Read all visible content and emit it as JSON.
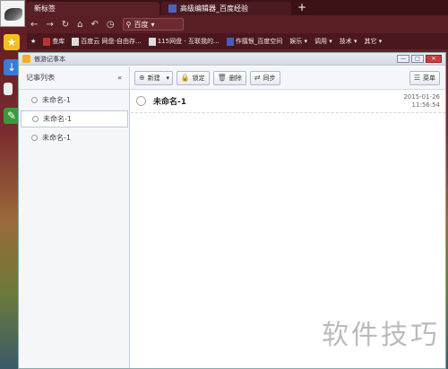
{
  "browser": {
    "tabs": [
      {
        "label": "新标签"
      },
      {
        "label": "高级编辑器_百度经验"
      }
    ],
    "new_tab": "+",
    "search": {
      "engine": "百度",
      "placeholder": ""
    },
    "bookmarks": [
      "查库",
      "百度云 网盘-自由存...",
      "115网盘 - 互联我的...",
      "作擂恨_百度空间",
      "娱乐 ▾",
      "调用 ▾",
      "技术 ▾",
      "其它 ▾"
    ]
  },
  "app": {
    "title": "傲游记事本",
    "controls": {
      "min": "—",
      "max": "□",
      "close": "✕"
    }
  },
  "sidebar": {
    "header": "记事列表",
    "collapse": "«",
    "items": [
      {
        "label": "未命名-1"
      },
      {
        "label": "未命名-1"
      },
      {
        "label": "未命名-1"
      }
    ]
  },
  "toolbar": {
    "new": "新建",
    "lock": "锁定",
    "delete": "删除",
    "sync": "同步",
    "menu": "菜单"
  },
  "note": {
    "title": "未命名-1",
    "date": "2015-01-26",
    "time": "11:56:54"
  },
  "watermark": "软件技巧"
}
